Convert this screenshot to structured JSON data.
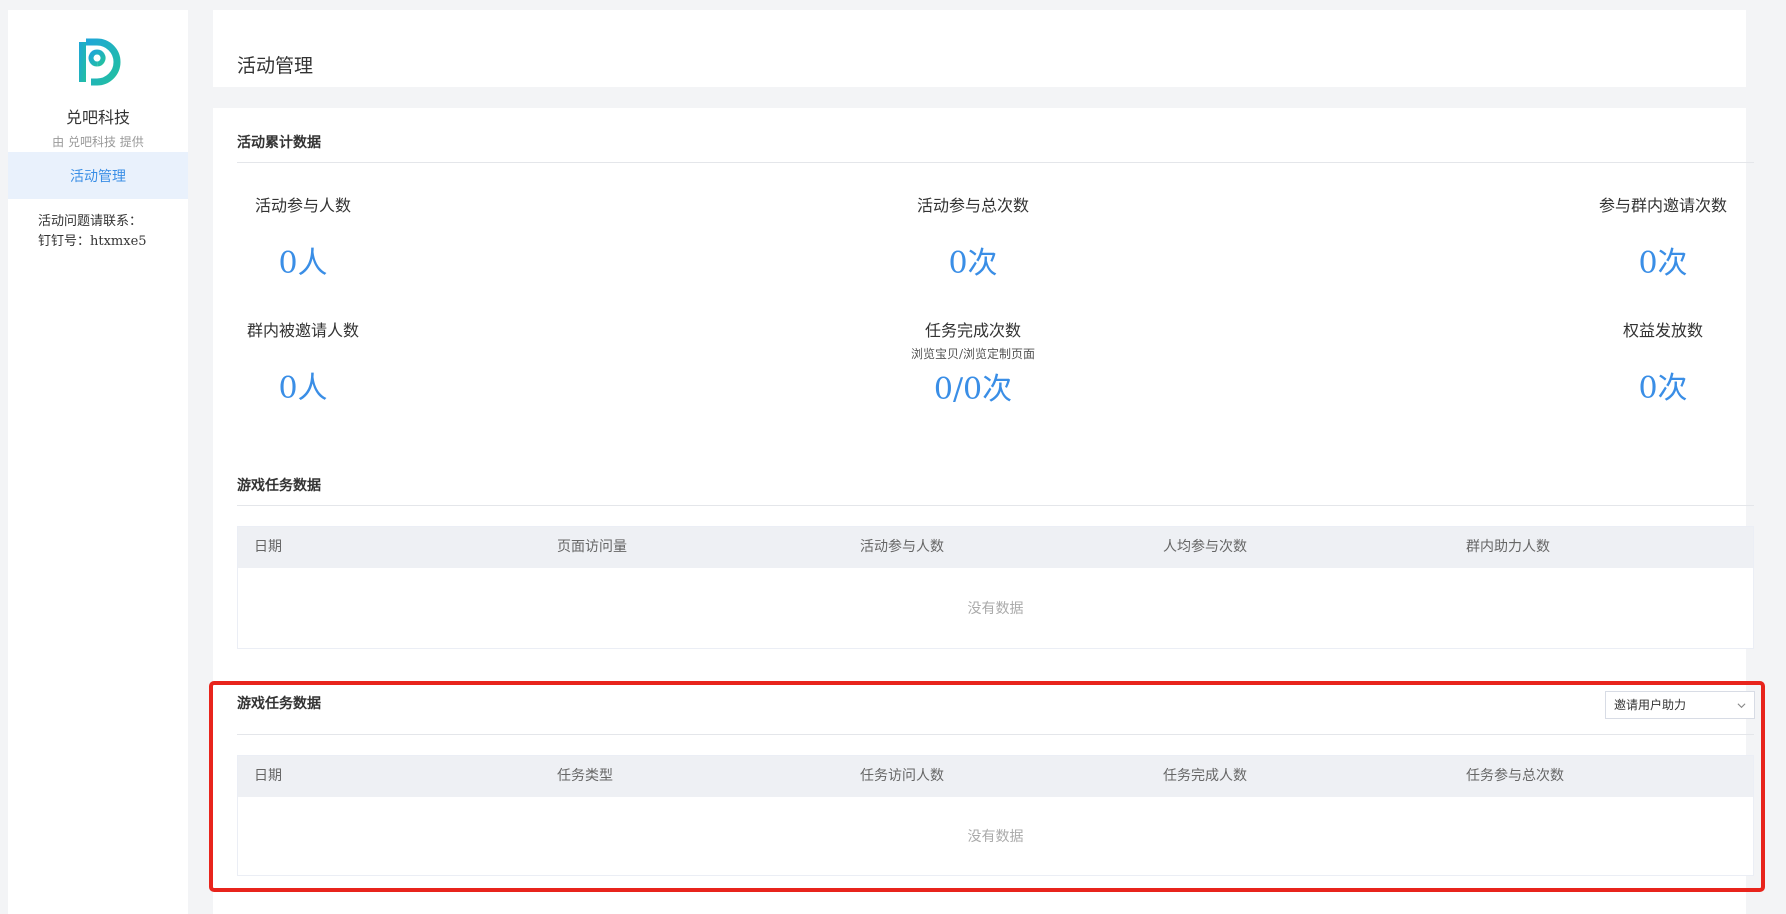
{
  "sidebar": {
    "brand_name": "兑吧科技",
    "brand_sub": "由 兑吧科技 提供",
    "nav_items": [
      {
        "label": "活动管理"
      }
    ],
    "contact_line1": "活动问题请联系：",
    "contact_line2": "钉钉号：htxmxe5"
  },
  "header": {
    "title": "活动管理"
  },
  "summary": {
    "title": "活动累计数据",
    "stats": [
      {
        "label": "活动参与人数",
        "sub": "",
        "value": "0人"
      },
      {
        "label": "活动参与总次数",
        "sub": "",
        "value": "0次"
      },
      {
        "label": "参与群内邀请次数",
        "sub": "",
        "value": "0次"
      },
      {
        "label": "群内被邀请人数",
        "sub": "",
        "value": "0人"
      },
      {
        "label": "任务完成次数",
        "sub": "浏览宝贝/浏览定制页面",
        "value": "0/0次"
      },
      {
        "label": "权益发放数",
        "sub": "",
        "value": "0次"
      }
    ]
  },
  "game_table1": {
    "title": "游戏任务数据",
    "columns": [
      "日期",
      "页面访问量",
      "活动参与人数",
      "人均参与次数",
      "群内助力人数"
    ],
    "empty_text": "没有数据"
  },
  "game_table2": {
    "title": "游戏任务数据",
    "select_value": "邀请用户助力",
    "columns": [
      "日期",
      "任务类型",
      "任务访问人数",
      "任务完成人数",
      "任务参与总次数"
    ],
    "empty_text": "没有数据"
  },
  "colors": {
    "accent": "#3a8ee6",
    "highlight": "#e8241c"
  }
}
